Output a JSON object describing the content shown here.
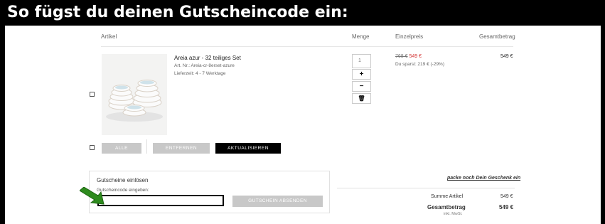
{
  "banner": {
    "title": "So fügst du deinen Gutscheincode ein:"
  },
  "table": {
    "headers": {
      "article": "Artikel",
      "quantity": "Menge",
      "unit_price": "Einzelpreis",
      "total": "Gesamtbetrag"
    }
  },
  "item": {
    "name": "Areia azur - 32 teiliges Set",
    "art_nr": "Art. Nr.: Areia-cr-8erset-azure",
    "delivery": "Lieferzeit: 4 - 7 Werktage",
    "quantity": "1",
    "plus_label": "+",
    "minus_label": "−",
    "delete_label": "🗑",
    "old_price": "768 €",
    "new_price": "549 €",
    "savings": "Du sparst: 219 € (-29%)",
    "total": "549 €"
  },
  "actions": {
    "all_label": "ALLE",
    "remove_label": "ENTFERNEN",
    "update_label": "AKTUALISIEREN"
  },
  "coupon": {
    "title": "Gutscheine einlösen",
    "input_label": "Gutscheincode eingeben:",
    "input_value": "",
    "submit_label": "GUTSCHEIN ABSENDEN"
  },
  "summary": {
    "gift_link": "packe noch Dein Geschenk ein",
    "subtotal_label": "Summe Artikel",
    "subtotal_value": "549 €",
    "total_label": "Gesamtbetrag",
    "total_value": "549 €",
    "vat_note": "inkl. MwSt."
  },
  "colors": {
    "accent_red": "#d23030",
    "arrow_green": "#2e8b1e",
    "button_gray": "#c8c8c8"
  }
}
